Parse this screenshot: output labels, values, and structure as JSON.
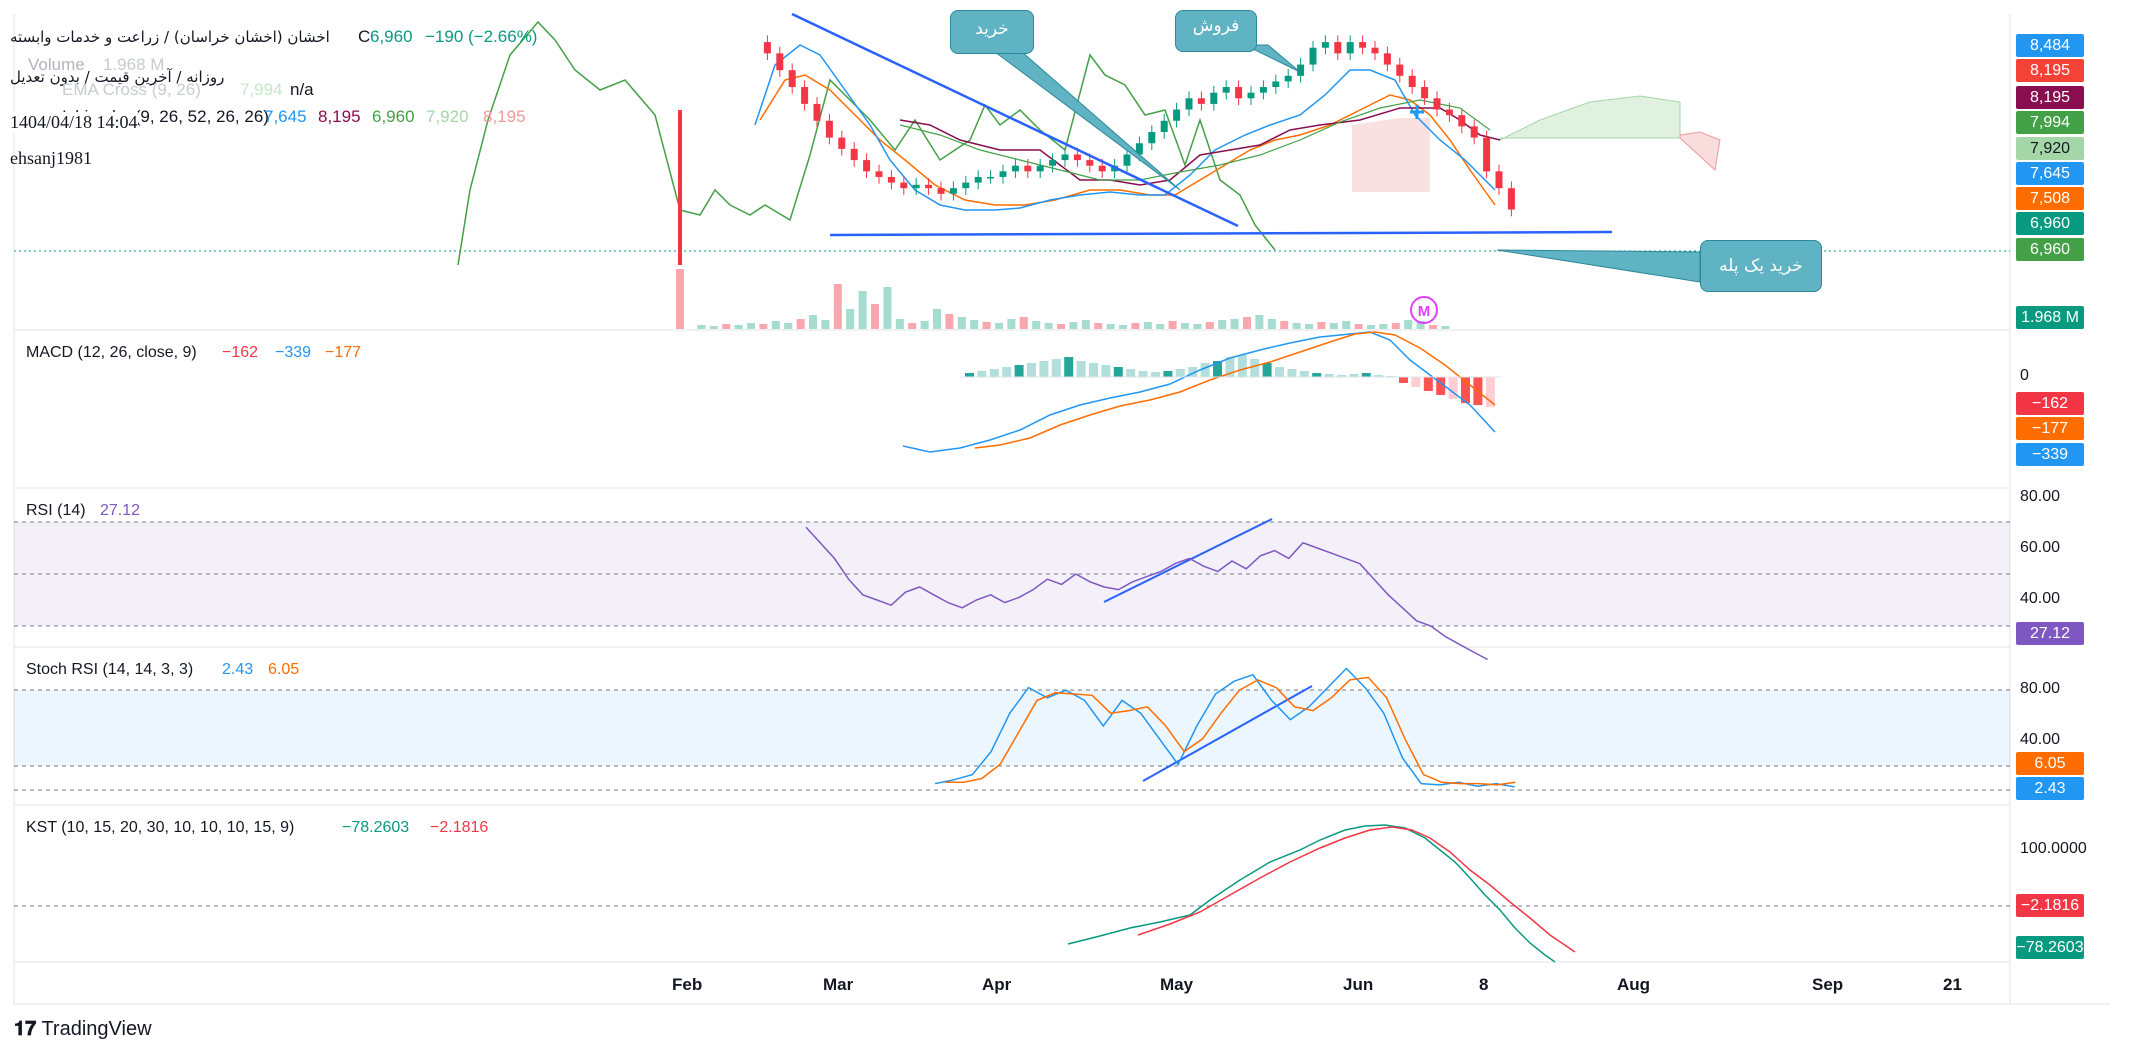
{
  "header": {
    "symbol_line": "اخشان (اخشان خراسان) / زراعت و خدمات وابسته",
    "close_prefix": "C",
    "close": "6,960",
    "change": "−190 (−2.66%)",
    "volume_label": "Volume",
    "volume_value": "1.968 M",
    "timeframe_line": "روزانه / آخرین قیمت / بدون تعدیل",
    "na": "n/a",
    "ema_label": "EMA Cross (9, 26)",
    "ema_value": "7,994",
    "ichimoku_label": "Ichimoku (9, 26, 52, 26, 26)",
    "ichi_values": [
      "7,645",
      "8,195",
      "6,960",
      "7,920",
      "8,195"
    ],
    "datetime": "1404/04/18 14:04",
    "author": "ehsanj1981"
  },
  "price_badges": [
    {
      "value": "8,484",
      "color": "#2196f3"
    },
    {
      "value": "8,195",
      "color": "#f44336"
    },
    {
      "value": "8,195",
      "color": "#880e4f"
    },
    {
      "value": "7,994",
      "color": "#43a047"
    },
    {
      "value": "7,920",
      "color": "#a5d6a7"
    },
    {
      "value": "7,645",
      "color": "#2196f3"
    },
    {
      "value": "7,508",
      "color": "#ff6d00"
    },
    {
      "value": "6,960",
      "color": "#089981"
    },
    {
      "value": "6,960",
      "color": "#43a047"
    }
  ],
  "volume_badge": "1.968 M",
  "callouts": {
    "buy": "خرید",
    "sell": "فروش",
    "buy_step": "خرید یک پله"
  },
  "macd": {
    "label": "MACD (12, 26, close, 9)",
    "values": [
      "−162",
      "−339",
      "−177"
    ],
    "axis_zero": "0",
    "badges": [
      {
        "value": "−162",
        "color": "#f23645"
      },
      {
        "value": "−177",
        "color": "#ff6d00"
      },
      {
        "value": "−339",
        "color": "#2196f3"
      }
    ]
  },
  "rsi": {
    "label": "RSI (14)",
    "value": "27.12",
    "axis": [
      "80.00",
      "60.00",
      "40.00"
    ],
    "badge": "27.12"
  },
  "stoch": {
    "label": "Stoch RSI (14, 14, 3, 3)",
    "k": "2.43",
    "d": "6.05",
    "axis": [
      "80.00",
      "40.00"
    ],
    "badges": [
      {
        "value": "6.05",
        "color": "#ff6d00"
      },
      {
        "value": "2.43",
        "color": "#2196f3"
      }
    ]
  },
  "kst": {
    "label": "KST (10, 15, 20, 30, 10, 10, 10, 15, 9)",
    "kst_value": "−78.2603",
    "signal_value": "−2.1816",
    "axis": [
      "100.0000"
    ],
    "badges": [
      {
        "value": "−2.1816",
        "color": "#f23645"
      },
      {
        "value": "−78.2603",
        "color": "#089981"
      }
    ]
  },
  "x_axis": [
    "Feb",
    "Mar",
    "Apr",
    "May",
    "Jun",
    "8",
    "Aug",
    "Sep",
    "21"
  ],
  "brand": "TradingView",
  "chart_data": [
    {
      "type": "candlestick",
      "pane": "price",
      "x_months": [
        "Feb",
        "Mar",
        "Apr",
        "May",
        "Jun",
        "Aug",
        "Sep"
      ],
      "last_close": 6960,
      "close_sequence": [
        8450,
        8350,
        8200,
        8050,
        7900,
        7750,
        7600,
        7500,
        7400,
        7300,
        7250,
        7200,
        7150,
        7180,
        7150,
        7100,
        7150,
        7200,
        7250,
        7250,
        7300,
        7350,
        7300,
        7350,
        7400,
        7450,
        7400,
        7350,
        7300,
        7350,
        7450,
        7550,
        7650,
        7750,
        7850,
        7950,
        7900,
        8000,
        8050,
        7950,
        8000,
        8050,
        8100,
        8150,
        8250,
        8400,
        8450,
        8350,
        8450,
        8400,
        8350,
        8250,
        8150,
        8050,
        7950,
        7850,
        7800,
        7700,
        7600,
        7300,
        7150,
        6960
      ]
    },
    {
      "type": "bar",
      "pane": "volume",
      "last_value": "1.968 M"
    },
    {
      "type": "line",
      "pane": "MACD",
      "series": [
        {
          "name": "MACD",
          "last": -339
        },
        {
          "name": "Signal",
          "last": -177
        },
        {
          "name": "Histogram",
          "last": -162
        }
      ]
    },
    {
      "type": "line",
      "pane": "RSI",
      "ylim": [
        20,
        80
      ],
      "series": [
        {
          "name": "RSI",
          "values": [
            78,
            72,
            66,
            58,
            52,
            50,
            48,
            53,
            55,
            52,
            49,
            47,
            50,
            52,
            49,
            51,
            54,
            58,
            56,
            60,
            57,
            55,
            54,
            57,
            59,
            61,
            64,
            66,
            63,
            61,
            65,
            62,
            67,
            69,
            66,
            72,
            70,
            68,
            66,
            64,
            58,
            52,
            47,
            42,
            40,
            36,
            33,
            30,
            27.12
          ]
        }
      ]
    },
    {
      "type": "line",
      "pane": "Stoch RSI",
      "ylim": [
        0,
        100
      ],
      "series": [
        {
          "name": "K",
          "values": [
            5,
            8,
            12,
            30,
            60,
            80,
            72,
            78,
            70,
            50,
            70,
            60,
            40,
            20,
            50,
            75,
            85,
            90,
            70,
            55,
            65,
            80,
            95,
            80,
            60,
            25,
            5,
            4,
            6,
            3,
            5,
            2.43
          ]
        },
        {
          "name": "D",
          "values": [
            6,
            6,
            9,
            20,
            45,
            70,
            76,
            75,
            74,
            60,
            62,
            65,
            50,
            30,
            40,
            60,
            78,
            86,
            80,
            65,
            62,
            72,
            86,
            88,
            72,
            40,
            12,
            6,
            5,
            5,
            4,
            6.05
          ]
        }
      ]
    },
    {
      "type": "line",
      "pane": "KST",
      "series": [
        {
          "name": "KST",
          "last": -78.2603
        },
        {
          "name": "Signal",
          "last": -2.1816
        }
      ]
    }
  ]
}
